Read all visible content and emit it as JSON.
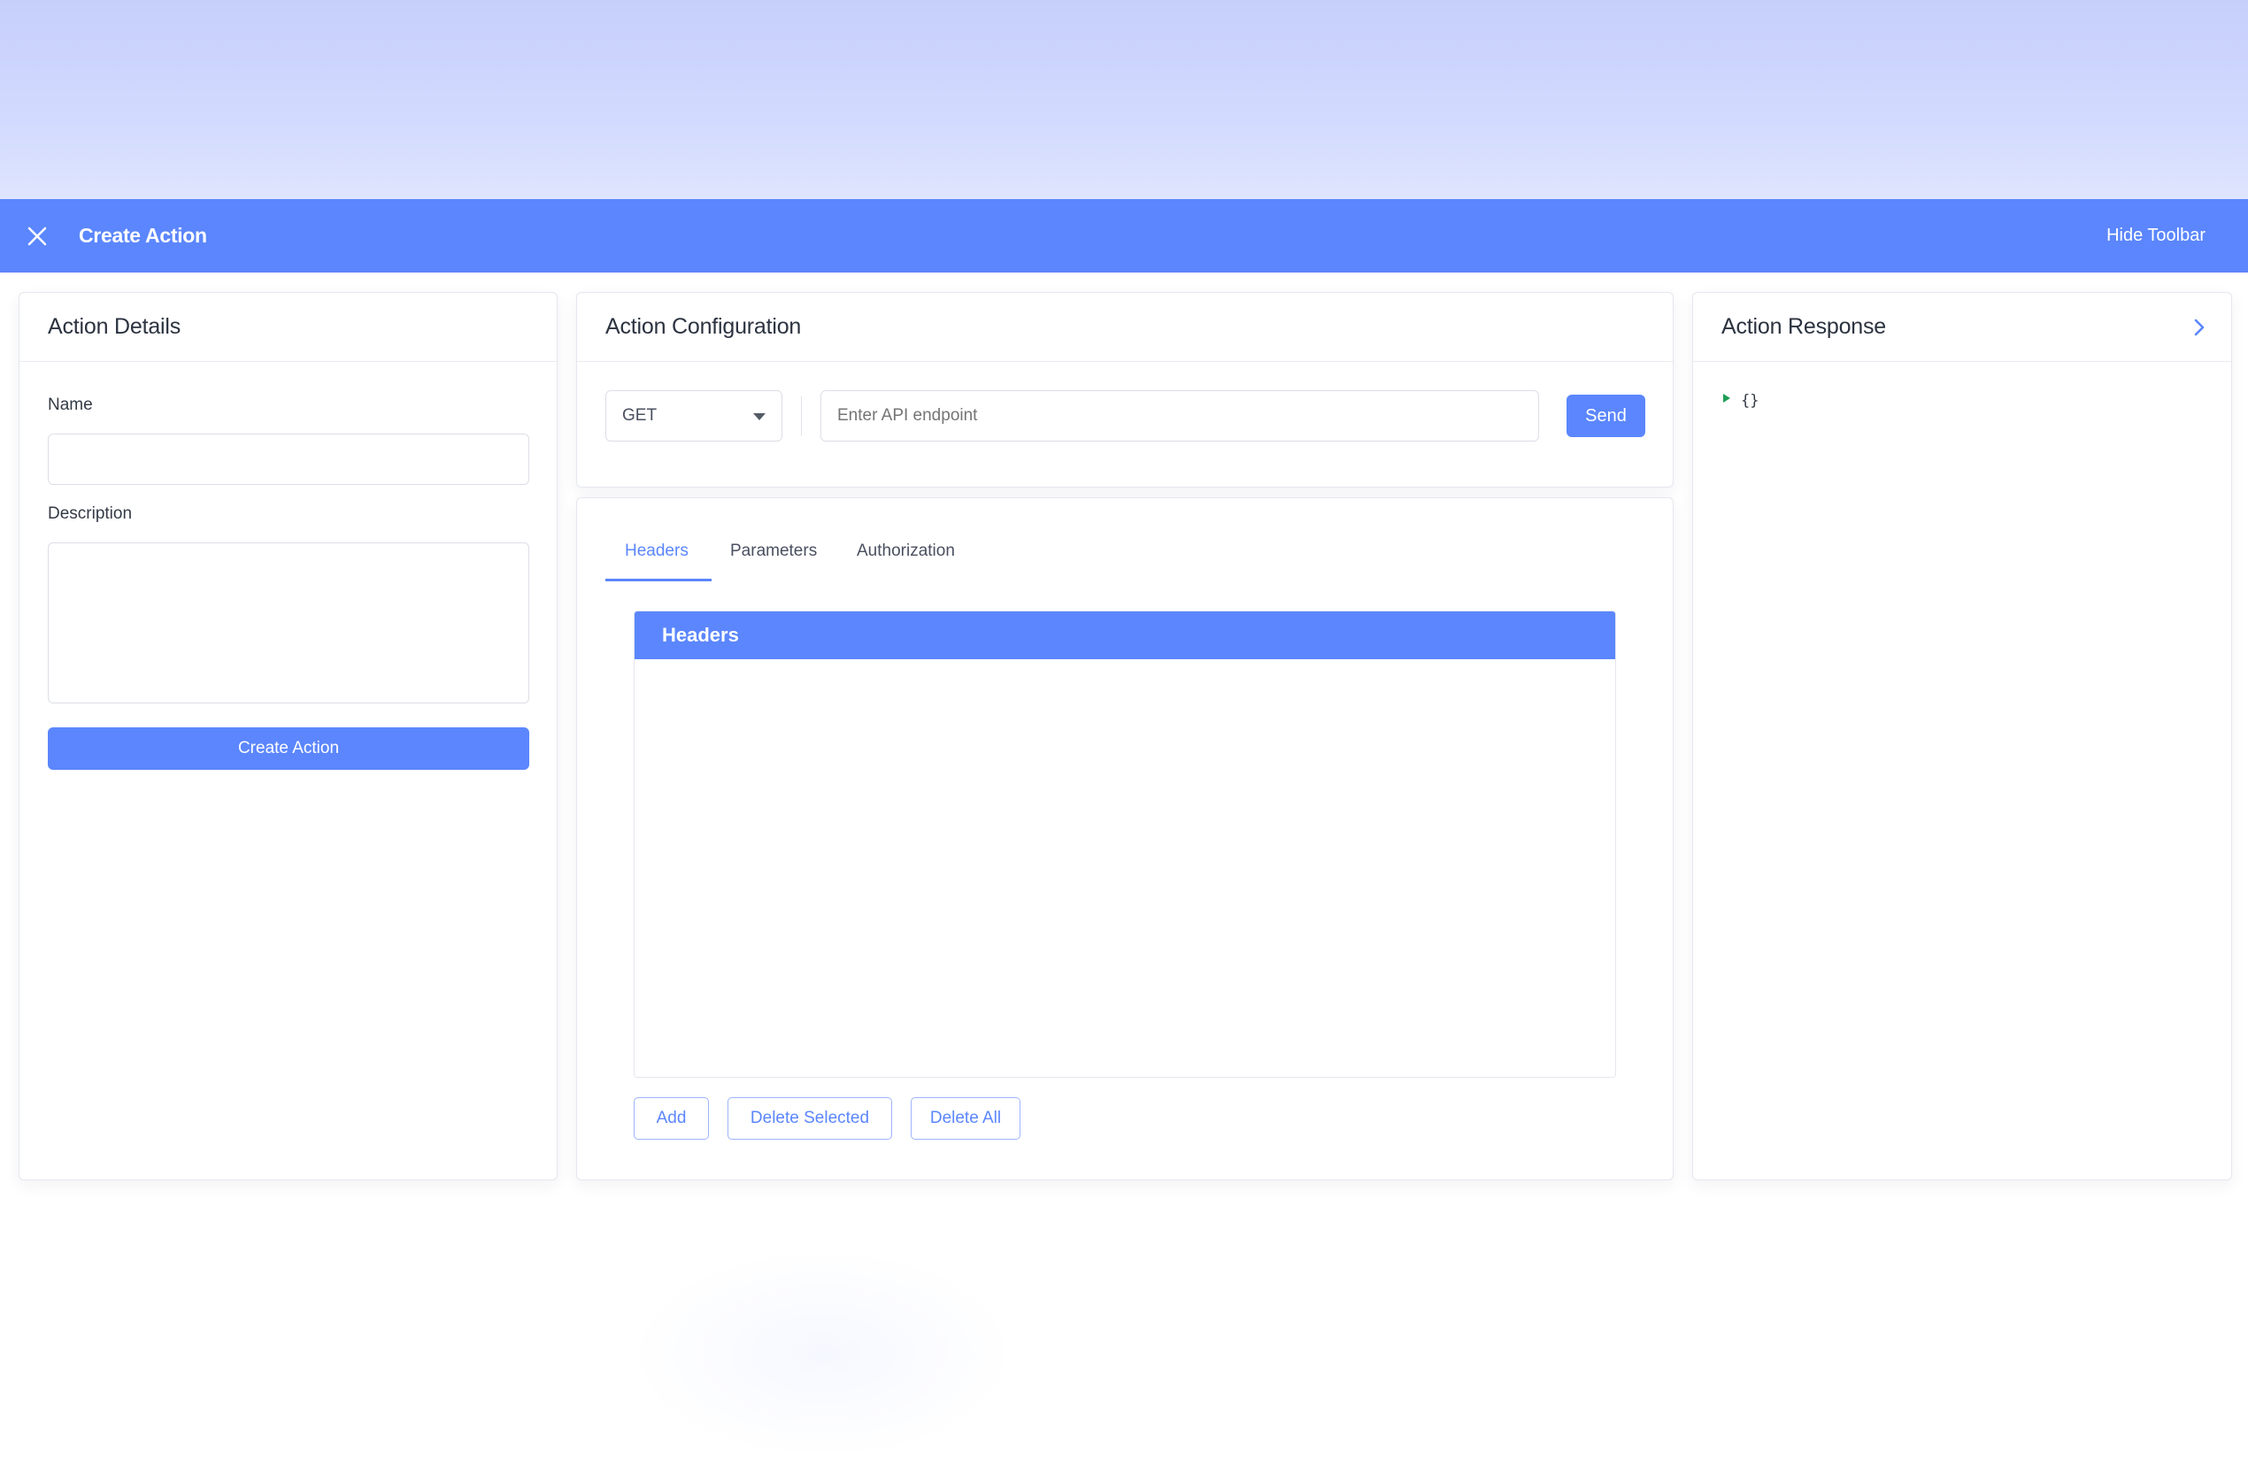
{
  "toolbar": {
    "title": "Create Action",
    "hide_label": "Hide Toolbar"
  },
  "details": {
    "heading": "Action Details",
    "name_label": "Name",
    "name_value": "",
    "description_label": "Description",
    "description_value": "",
    "create_button": "Create Action"
  },
  "config": {
    "heading": "Action Configuration",
    "method": "GET",
    "endpoint_placeholder": "Enter API endpoint",
    "endpoint_value": "",
    "send_button": "Send"
  },
  "tabs": [
    {
      "label": "Headers",
      "active": true
    },
    {
      "label": "Parameters",
      "active": false
    },
    {
      "label": "Authorization",
      "active": false
    }
  ],
  "headers_table": {
    "title": "Headers",
    "rows": []
  },
  "actions": {
    "add": "Add",
    "delete_selected": "Delete Selected",
    "delete_all": "Delete All"
  },
  "response": {
    "heading": "Action Response",
    "json_preview": "{}"
  },
  "colors": {
    "accent": "#5b86fd",
    "tree_arrow": "#1f9d55"
  }
}
